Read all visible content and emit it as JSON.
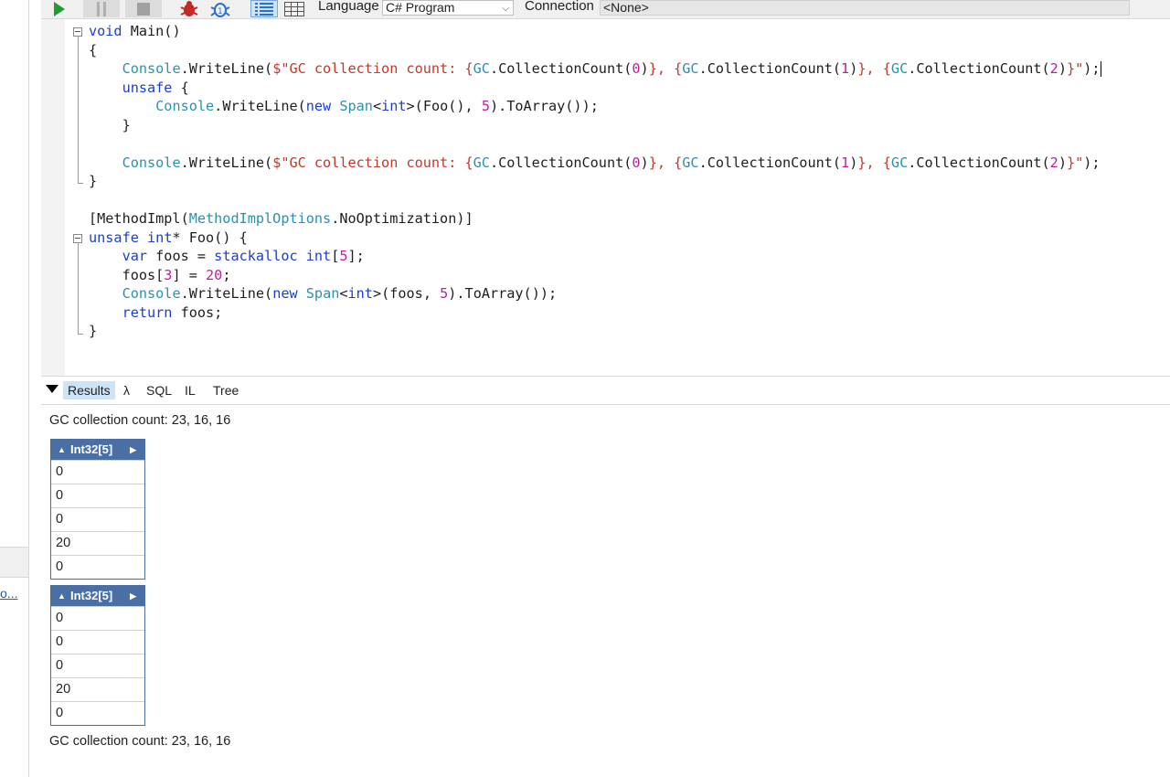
{
  "toolbar": {
    "language_label": "Language",
    "language_value": "C# Program",
    "connection_label": "Connection",
    "connection_value": "<None>",
    "colors": {
      "run": "#1e9e2f",
      "bug": "#c62828",
      "accent": "#2b6fd0"
    }
  },
  "left_panel": {
    "link_text": "o..."
  },
  "editor": {
    "code_lines": [
      "void Main()",
      "{",
      "    Console.WriteLine($\"GC collection count: {GC.CollectionCount(0)}, {GC.CollectionCount(1)}, {GC.CollectionCount(2)}\");",
      "    unsafe {",
      "        Console.WriteLine(new Span<int>(Foo(), 5).ToArray());",
      "    }",
      "",
      "    Console.WriteLine($\"GC collection count: {GC.CollectionCount(0)}, {GC.CollectionCount(1)}, {GC.CollectionCount(2)}\");",
      "}",
      "",
      "[MethodImpl(MethodImplOptions.NoOptimization)]",
      "unsafe int* Foo() {",
      "    var foos = stackalloc int[5];",
      "    foos[3] = 20;",
      "    Console.WriteLine(new Span<int>(foos, 5).ToArray());",
      "    return foos;",
      "}"
    ]
  },
  "results": {
    "tabs": [
      "Results",
      "λ",
      "SQL",
      "IL",
      "Tree"
    ],
    "active_tab": "Results",
    "output_first": "GC collection count: 23, 16, 16",
    "arrays": [
      {
        "title": "Int32[5]",
        "values": [
          "0",
          "0",
          "0",
          "20",
          "0"
        ]
      },
      {
        "title": "Int32[5]",
        "values": [
          "0",
          "0",
          "0",
          "20",
          "0"
        ]
      }
    ],
    "output_last": "GC collection count: 23, 16, 16"
  }
}
